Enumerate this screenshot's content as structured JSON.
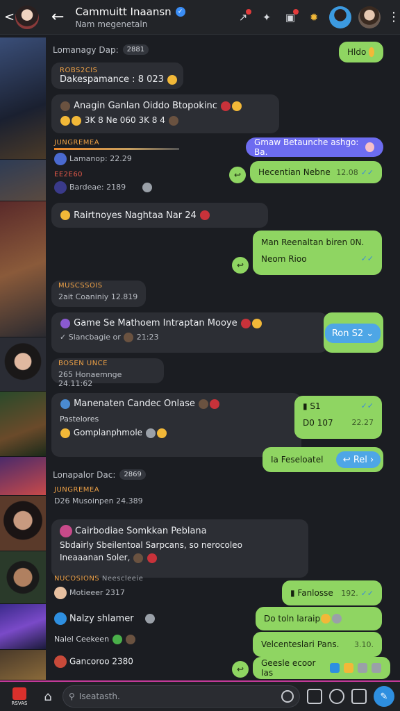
{
  "header": {
    "title": "Cammuitt Inaansn",
    "subtitle": "Nam megenetaln",
    "back_mini": "<",
    "back_arrow": "←",
    "kebab": "⋮"
  },
  "rail_colors": [
    "#2a3a55",
    "#3b2e45",
    "#4a3a2a",
    "#262a3a",
    "#3a2a2a",
    "#223a2a",
    "#3a2438",
    "#2f2a24",
    "#2a2f3a",
    "#3a2f44",
    "#4a3a24"
  ],
  "chat": {
    "date_sep_1": {
      "label": "Lomanagy Dap:",
      "pill": "2881"
    },
    "m1": {
      "sender": "ROBS2CIS",
      "text": "Dakespamance : 8 023"
    },
    "m2": {
      "line1": "Anagin Ganlan Oiddo Btopokinc",
      "line2": "3K 8 Ne 060 3K 8 4"
    },
    "m3": {
      "text": "Gmaw Betaunche ashgo: Ba."
    },
    "m4": {
      "sender": "JUNGREMEA",
      "text": "Lamanop: 22.29"
    },
    "m5": {
      "text": "Hecentian Nebne",
      "time": "12.08"
    },
    "m6": {
      "sender": "EE2E60",
      "text": "Bardeae: 2189"
    },
    "m7": {
      "text": "Rairtnoyes Naghtaa Nar 24"
    },
    "m8": {
      "line1": "Man Reenaltan biren 0N.",
      "line2": "Neom Rioo"
    },
    "m9": {
      "sender": "MUSCSSOIS",
      "text": "2ait Coaniniy 12.819"
    },
    "m10": {
      "title": "Game Se Mathoem Intraptan Mooye",
      "sub": "Slancbagie or",
      "time": "21:23"
    },
    "m11": {
      "text": "Ron S2"
    },
    "m12": {
      "sender": "BOSEN UNCE",
      "text": "265 Honaemnge 24.11:62"
    },
    "m13": {
      "line1": "Manenaten Candec Onlase",
      "line2": "Pastelores",
      "line3": "Gomplanphmole"
    },
    "m14": {
      "line1": "S1",
      "line2": "D0 107",
      "time": "22.27"
    },
    "m15": {
      "text": "Ia Feseloatel"
    },
    "m16": {
      "text": "Rel"
    },
    "date_sep_2": {
      "label": "Lonapalor Dac:",
      "pill": "2869"
    },
    "m17": {
      "sender": "JUNGREMEA",
      "text": "D26 Musoinpen 24.389"
    },
    "m18": {
      "line1": "Cairbodiae Somkkan Peblana",
      "line2": "Sbdairly Sbeilentoal Sarpcans, so nerocoleo",
      "line3": "Ineaaanan Soler,"
    },
    "m19": {
      "sender": "NUCOSIONS",
      "tag": "Neescleeie",
      "text": "Motieeer 2317"
    },
    "m20": {
      "text": "Fanlosse",
      "time": "192."
    },
    "m21": {
      "text": "Nalzy shlamer"
    },
    "m22": {
      "text": "Do toln laraip"
    },
    "m23": {
      "text": "Nalel Ceekeen"
    },
    "m24": {
      "text": "Velcenteslari Pans.",
      "time": "3.10."
    },
    "m25": {
      "text": "Gancoroo 2380"
    },
    "m26": {
      "text": "Geesle ecoor Ias"
    },
    "m27": {
      "text": "Hldo"
    }
  },
  "bottom": {
    "app_label": "RSVAS",
    "search_placeholder": "Iseatasth."
  },
  "colors": {
    "incoming": "#2c2e34",
    "outgoing": "#8fd562",
    "accent_blue": "#4ea6e6",
    "purple": "#6d6cf0",
    "sender_orange": "#f0a246"
  }
}
